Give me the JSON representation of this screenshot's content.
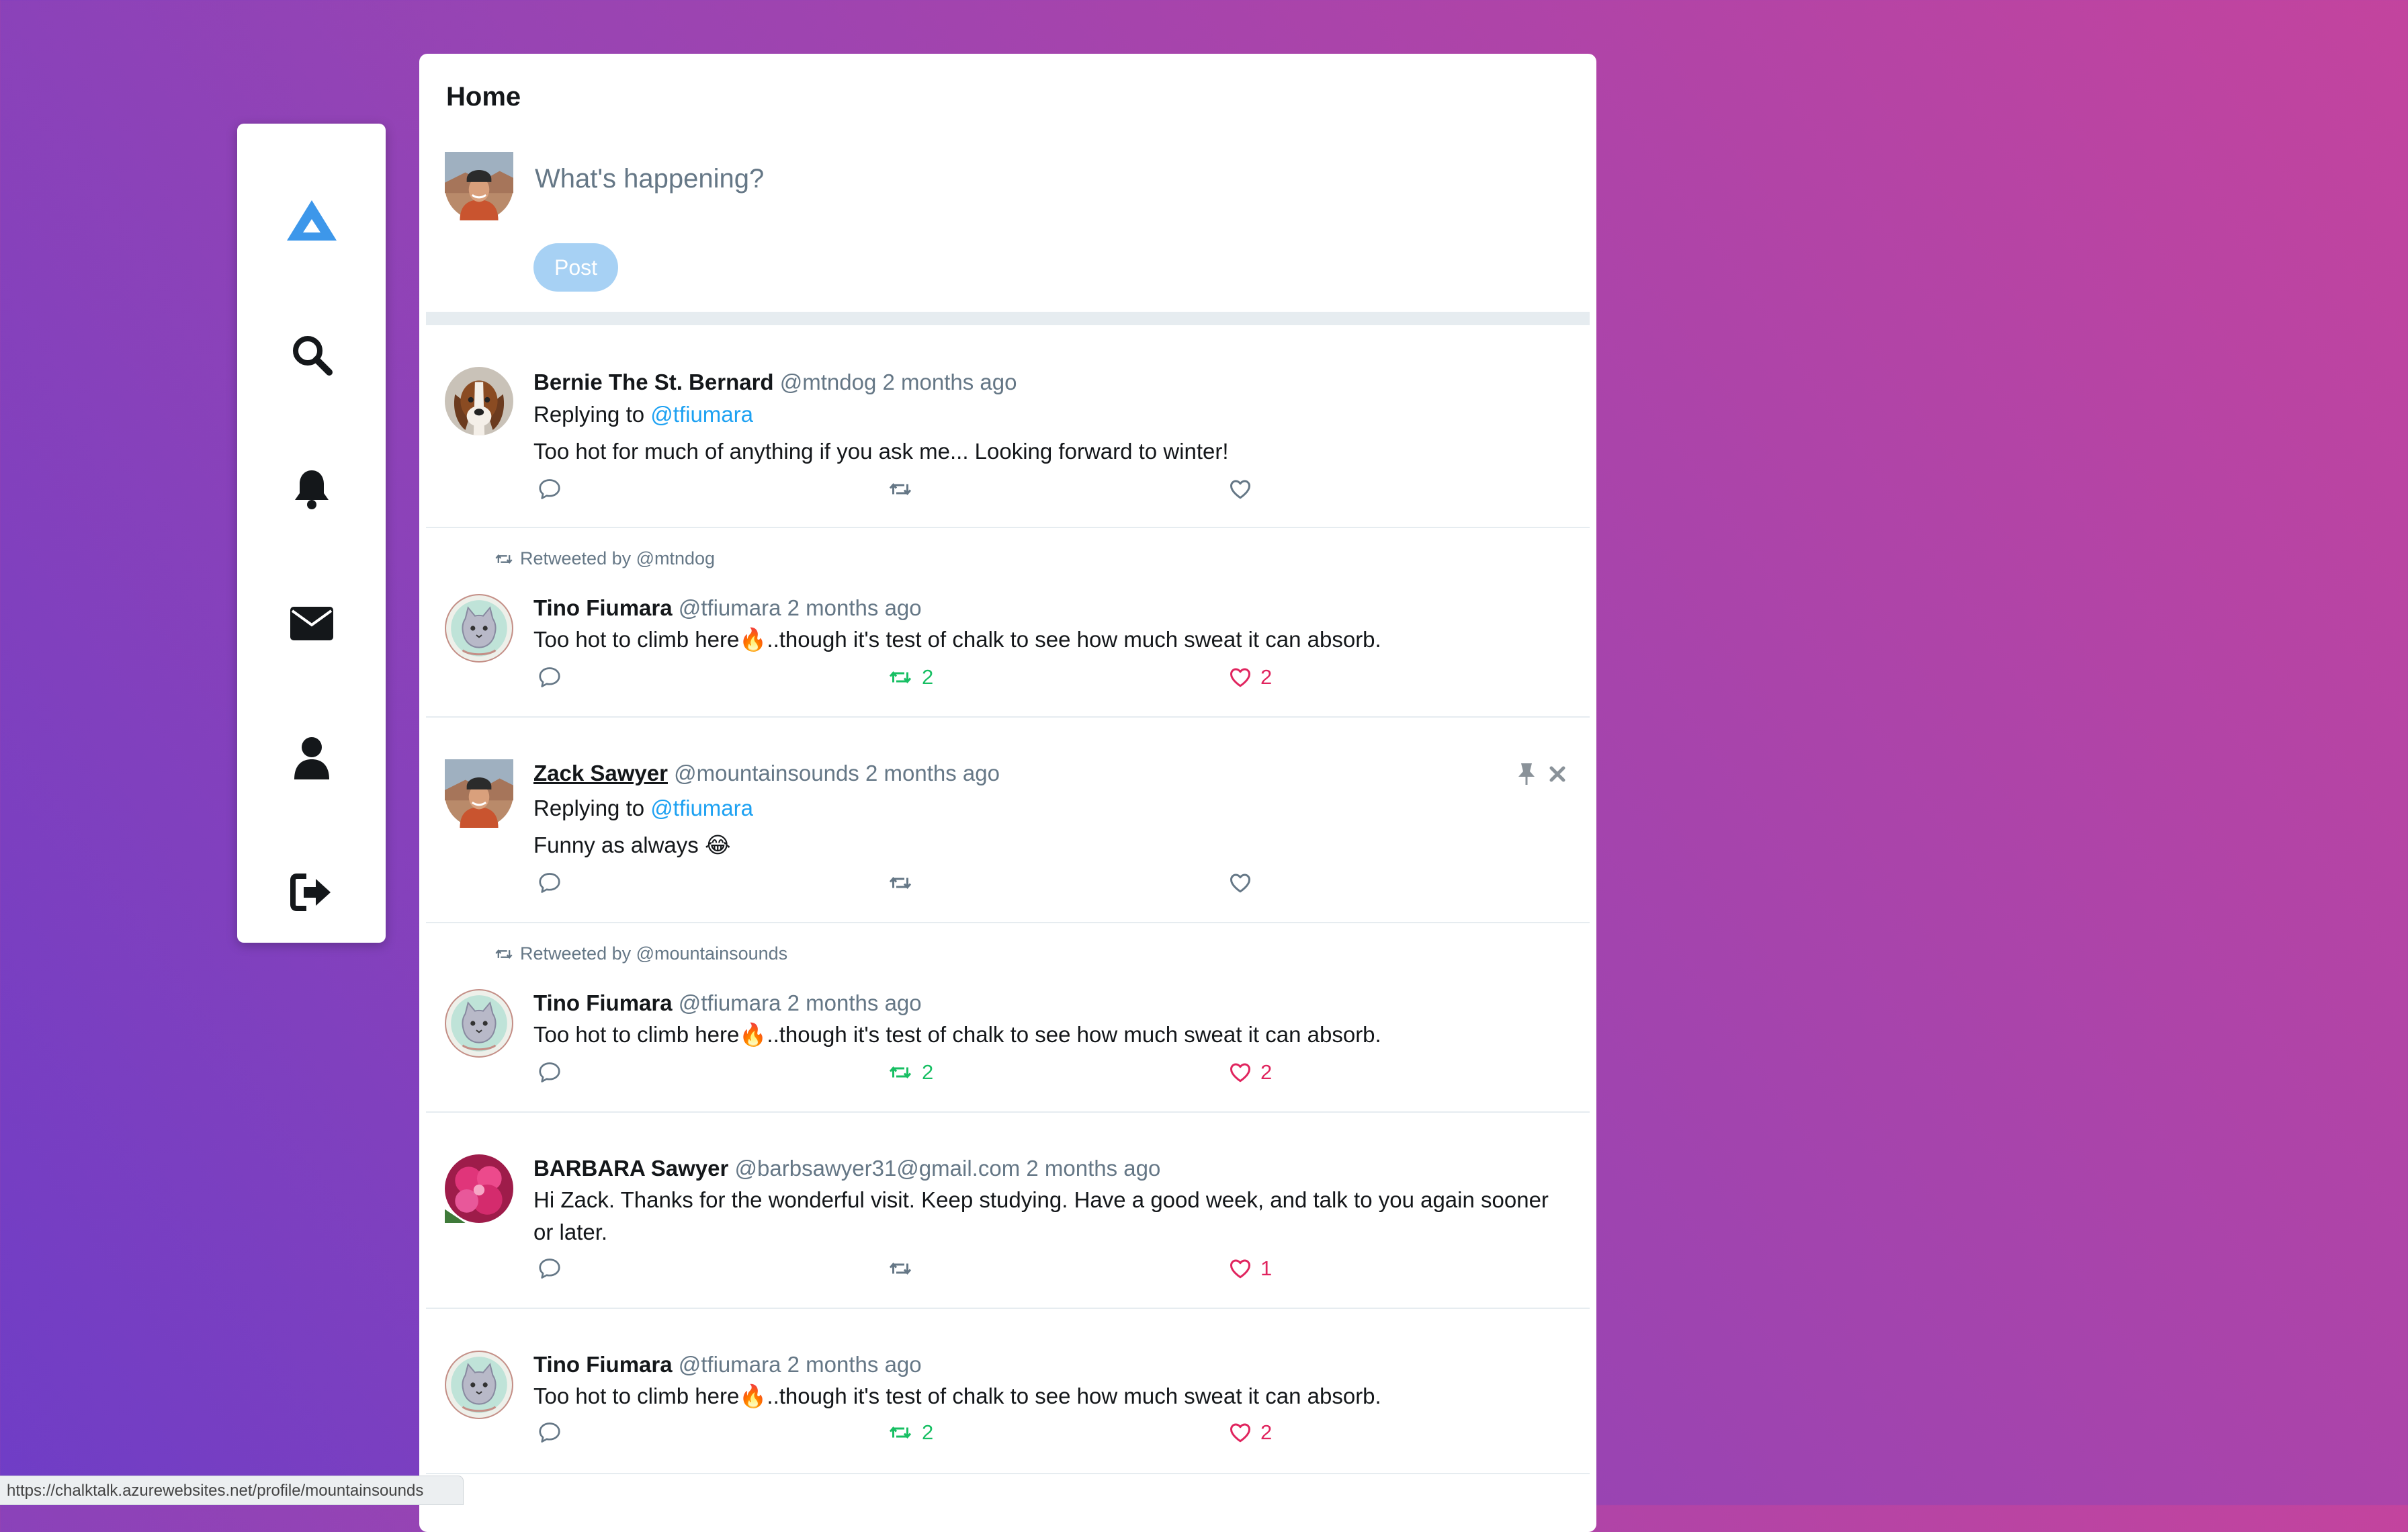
{
  "header": {
    "title": "Home"
  },
  "compose": {
    "placeholder": "What's happening?",
    "post_label": "Post"
  },
  "sidebar": {
    "items": [
      {
        "name": "home",
        "icon": "mountain-icon"
      },
      {
        "name": "search",
        "icon": "search-icon"
      },
      {
        "name": "notifications",
        "icon": "bell-icon"
      },
      {
        "name": "messages",
        "icon": "envelope-icon"
      },
      {
        "name": "profile",
        "icon": "user-icon"
      },
      {
        "name": "logout",
        "icon": "logout-icon"
      }
    ]
  },
  "tweets": [
    {
      "name": "Bernie The St. Bernard",
      "handle": "@mtndog",
      "time": "2 months ago",
      "replying_prefix": "Replying to",
      "replying_to": "@tfiumara",
      "text": "Too hot for much of anything if you ask me... Looking forward to winter!",
      "retweets": "",
      "likes": ""
    },
    {
      "retweeted_by": "Retweeted by @mtndog",
      "name": "Tino Fiumara",
      "handle": "@tfiumara",
      "time": "2 months ago",
      "text": "Too hot to climb here🔥..though it's test of chalk to see how much sweat it can absorb.",
      "retweets": "2",
      "likes": "2"
    },
    {
      "name": "Zack Sawyer",
      "handle": "@mountainsounds",
      "time": "2 months ago",
      "replying_prefix": "Replying to",
      "replying_to": "@tfiumara",
      "text": "Funny as always 😂",
      "retweets": "",
      "likes": ""
    },
    {
      "retweeted_by": "Retweeted by @mountainsounds",
      "name": "Tino Fiumara",
      "handle": "@tfiumara",
      "time": "2 months ago",
      "text": "Too hot to climb here🔥..though it's test of chalk to see how much sweat it can absorb.",
      "retweets": "2",
      "likes": "2"
    },
    {
      "name": "BARBARA Sawyer",
      "handle": "@barbsawyer31@gmail.com",
      "time": "2 months ago",
      "text": "Hi Zack. Thanks for the wonderful visit. Keep studying. Have a good week, and talk to you again sooner or later.",
      "retweets": "",
      "likes": "1"
    },
    {
      "name": "Tino Fiumara",
      "handle": "@tfiumara",
      "time": "2 months ago",
      "text": "Too hot to climb here🔥..though it's test of chalk to see how much sweat it can absorb.",
      "retweets": "2",
      "likes": "2"
    }
  ],
  "status_bar": {
    "url": "https://chalktalk.azurewebsites.net/profile/mountainsounds"
  },
  "colors": {
    "accent": "#1da1f2",
    "retweet": "#17bf63",
    "like": "#e0245e",
    "muted": "#657786"
  }
}
